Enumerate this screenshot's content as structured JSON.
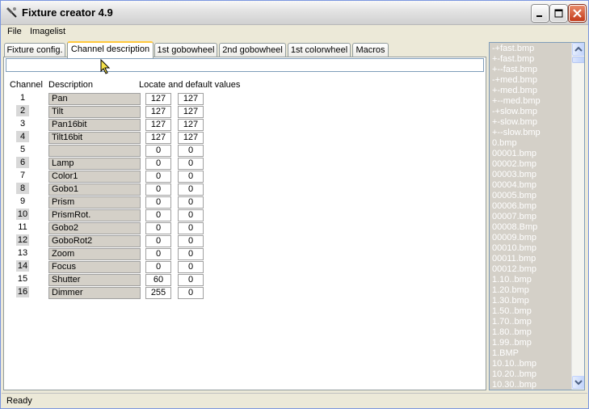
{
  "window": {
    "title": "Fixture creator 4.9"
  },
  "menu": {
    "file": "File",
    "imagelist": "Imagelist"
  },
  "tabs": [
    {
      "label": "Fixture config."
    },
    {
      "label": "Channel description"
    },
    {
      "label": "1st gobowheel"
    },
    {
      "label": "2nd gobowheel"
    },
    {
      "label": "1st colorwheel"
    },
    {
      "label": "Macros"
    }
  ],
  "headers": {
    "channel": "Channel",
    "description": "Description",
    "values": "Locate and default values"
  },
  "channels": [
    {
      "num": "1",
      "desc": "Pan",
      "locate": "127",
      "default": "127"
    },
    {
      "num": "2",
      "desc": "Tilt",
      "locate": "127",
      "default": "127"
    },
    {
      "num": "3",
      "desc": "Pan16bit",
      "locate": "127",
      "default": "127"
    },
    {
      "num": "4",
      "desc": "Tilt16bit",
      "locate": "127",
      "default": "127"
    },
    {
      "num": "5",
      "desc": "",
      "locate": "0",
      "default": "0"
    },
    {
      "num": "6",
      "desc": "Lamp",
      "locate": "0",
      "default": "0"
    },
    {
      "num": "7",
      "desc": "Color1",
      "locate": "0",
      "default": "0"
    },
    {
      "num": "8",
      "desc": "Gobo1",
      "locate": "0",
      "default": "0"
    },
    {
      "num": "9",
      "desc": "Prism",
      "locate": "0",
      "default": "0"
    },
    {
      "num": "10",
      "desc": "PrismRot.",
      "locate": "0",
      "default": "0"
    },
    {
      "num": "11",
      "desc": "Gobo2",
      "locate": "0",
      "default": "0"
    },
    {
      "num": "12",
      "desc": "GoboRot2",
      "locate": "0",
      "default": "0"
    },
    {
      "num": "13",
      "desc": "Zoom",
      "locate": "0",
      "default": "0"
    },
    {
      "num": "14",
      "desc": "Focus",
      "locate": "0",
      "default": "0"
    },
    {
      "num": "15",
      "desc": "Shutter",
      "locate": "60",
      "default": "0"
    },
    {
      "num": "16",
      "desc": "Dimmer",
      "locate": "255",
      "default": "0"
    }
  ],
  "imagelist": [
    "-+fast.bmp",
    "+-fast.bmp",
    "+--fast.bmp",
    "-+med.bmp",
    "+-med.bmp",
    "+--med.bmp",
    "-+slow.bmp",
    "+-slow.bmp",
    "+--slow.bmp",
    "0.bmp",
    "00001.bmp",
    "00002.bmp",
    "00003.bmp",
    "00004.bmp",
    "00005.bmp",
    "00006.bmp",
    "00007.bmp",
    "00008.Bmp",
    "00009.bmp",
    "00010.bmp",
    "00011.bmp",
    "00012.bmp",
    "1.10..bmp",
    "1.20.bmp",
    "1.30.bmp",
    "1.50..bmp",
    "1.70..bmp",
    "1.80..bmp",
    "1.99..bmp",
    "1.BMP",
    "10.10..bmp",
    "10.20..bmp",
    "10.30..bmp"
  ],
  "status": {
    "text": "Ready"
  }
}
